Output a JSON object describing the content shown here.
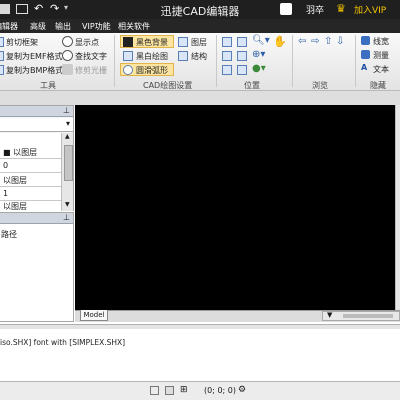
{
  "app": {
    "title": "迅捷CAD编辑器",
    "user": "羽卒",
    "vip_label": "加入VIP"
  },
  "menu": [
    "编辑器",
    "高级",
    "输出",
    "VIP功能",
    "相关软件"
  ],
  "ribbon": {
    "tools": {
      "items": [
        "剪切框架",
        "复制为EMF格式",
        "复制为BMP格式",
        "显示点",
        "查找文字",
        "修剪光栅"
      ],
      "label": "工具"
    },
    "cad_settings": {
      "items": [
        "黑色背景",
        "黑白绘图",
        "圆滑弧形",
        "图层",
        "结构"
      ],
      "label": "CAD绘图设置"
    },
    "position": {
      "label": "位置"
    },
    "browse": {
      "label": "浏览"
    },
    "hide": {
      "items": [
        "线宽",
        "测量",
        "文本"
      ],
      "label": "隐藏"
    }
  },
  "left_panel": {
    "pin_icon": "pin-icon",
    "grid_rows": [
      "■ 以图层",
      "0",
      "以图层",
      "1",
      "以图层"
    ],
    "bottom_text": "路径"
  },
  "drawing": {
    "background": "#000000",
    "tab_model": "Model"
  },
  "command": {
    "line": "iso.SHX] font with [SIMPLEX.SHX]"
  },
  "status": {
    "coords": "(0; 0; 0)"
  },
  "colors": {
    "accent_gold": "#f5c400",
    "title_bg": "#1f1f1f",
    "highlight": "#fbe5a0"
  }
}
